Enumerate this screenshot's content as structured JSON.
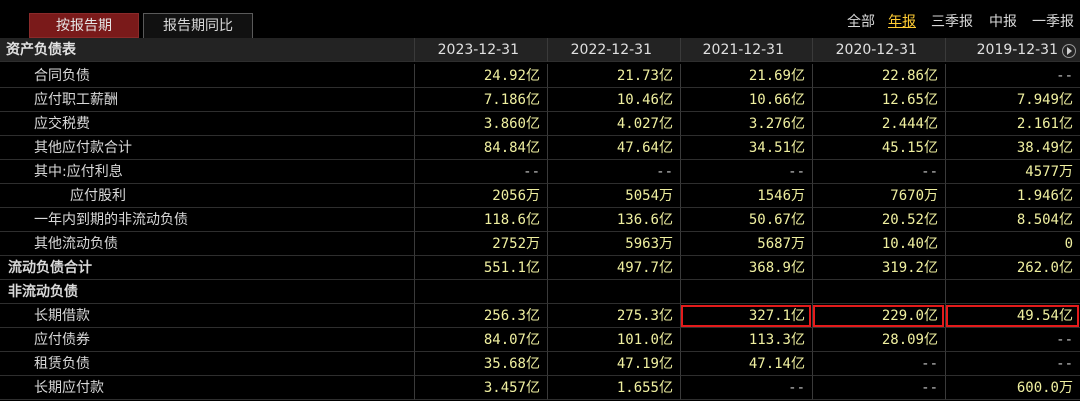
{
  "tabs": {
    "active": "按报告期",
    "other": "报告期同比"
  },
  "periods": {
    "all": "全部",
    "annual": "年报",
    "q3": "三季报",
    "mid": "中报",
    "q1": "一季报"
  },
  "header": {
    "section": "资产负债表",
    "dates": [
      "2023-12-31",
      "2022-12-31",
      "2021-12-31",
      "2020-12-31",
      "2019-12-31"
    ]
  },
  "rows": [
    {
      "label": "合同负债",
      "values": [
        "24.92亿",
        "21.73亿",
        "21.69亿",
        "22.86亿",
        "--"
      ]
    },
    {
      "label": "应付职工薪酬",
      "values": [
        "7.186亿",
        "10.46亿",
        "10.66亿",
        "12.65亿",
        "7.949亿"
      ]
    },
    {
      "label": "应交税费",
      "values": [
        "3.860亿",
        "4.027亿",
        "3.276亿",
        "2.444亿",
        "2.161亿"
      ]
    },
    {
      "label": "其他应付款合计",
      "values": [
        "84.84亿",
        "47.64亿",
        "34.51亿",
        "45.15亿",
        "38.49亿"
      ]
    },
    {
      "label": "其中:应付利息",
      "values": [
        "--",
        "--",
        "--",
        "--",
        "4577万"
      ]
    },
    {
      "label": "应付股利",
      "values": [
        "2056万",
        "5054万",
        "1546万",
        "7670万",
        "1.946亿"
      ]
    },
    {
      "label": "一年内到期的非流动负债",
      "values": [
        "118.6亿",
        "136.6亿",
        "50.67亿",
        "20.52亿",
        "8.504亿"
      ]
    },
    {
      "label": "其他流动负债",
      "values": [
        "2752万",
        "5963万",
        "5687万",
        "10.40亿",
        "0"
      ]
    },
    {
      "label": "流动负债合计",
      "values": [
        "551.1亿",
        "497.7亿",
        "368.9亿",
        "319.2亿",
        "262.0亿"
      ]
    },
    {
      "label": "非流动负债",
      "values": [
        "",
        "",
        "",
        "",
        ""
      ]
    },
    {
      "label": "长期借款",
      "values": [
        "256.3亿",
        "275.3亿",
        "327.1亿",
        "229.0亿",
        "49.54亿"
      ]
    },
    {
      "label": "应付债券",
      "values": [
        "84.07亿",
        "101.0亿",
        "113.3亿",
        "28.09亿",
        "--"
      ]
    },
    {
      "label": "租赁负债",
      "values": [
        "35.68亿",
        "47.19亿",
        "47.14亿",
        "--",
        "--"
      ]
    },
    {
      "label": "长期应付款",
      "values": [
        "3.457亿",
        "1.655亿",
        "--",
        "--",
        "600.0万"
      ]
    }
  ]
}
